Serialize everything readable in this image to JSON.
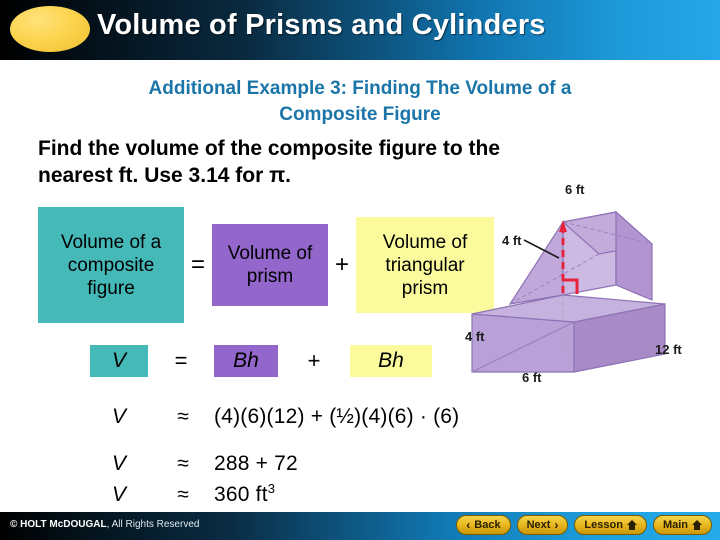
{
  "header": {
    "title": "Volume of Prisms and Cylinders",
    "ellipse_color": "#fcd44f",
    "gradient_start": "#000000",
    "gradient_end": "#25a6e6"
  },
  "subtitle": {
    "line1": "Additional Example 3: Finding The Volume of a",
    "line2": "Composite Figure",
    "color": "#1b75a8"
  },
  "problem": {
    "line1": "Find the volume of the composite figure to the",
    "line2": "nearest ft. Use 3.14 for ",
    "pi": "π."
  },
  "word_equation": {
    "term1": "Volume of a composite figure",
    "operator1": "=",
    "term2": "Volume of prism",
    "operator2": "+",
    "term3": "Volume of triangular prism",
    "term1_color": "#45b8b8",
    "term2_color": "#9366cc",
    "term3_color": "#fbfb9e"
  },
  "symbol_equation": {
    "lhs": "V",
    "operator1": "=",
    "term1": "Bh",
    "operator2": "+",
    "term2": "Bh"
  },
  "numeric_rows": [
    {
      "lhs": "V",
      "operator": "≈",
      "expression": "(4)(6)(12) + (½)(4)(6) · (6)"
    },
    {
      "lhs": "V",
      "operator": "≈",
      "expression": "288 +  72"
    },
    {
      "lhs": "V",
      "operator": "≈",
      "expression": "360 ft",
      "superscript": "3"
    }
  ],
  "figure": {
    "name": "composite-solid-rectangular-and-triangular-prism",
    "labels": {
      "top": "6 ft",
      "slant": "4 ft",
      "left_height": "4 ft",
      "length": "12 ft",
      "bottom_width": "6 ft"
    },
    "colors": {
      "front_face": "#a98cc8",
      "top_face": "#c9b4de",
      "side_face": "#b79ed2",
      "height_line": "#e8243c"
    }
  },
  "footer": {
    "copyright_bold": "© HOLT McDOUGAL",
    "copyright_rest": ", All Rights Reserved",
    "buttons": [
      {
        "label": "Back",
        "icon": "chevron-left-icon"
      },
      {
        "label": "Next",
        "icon": "chevron-right-icon"
      },
      {
        "label": "Lesson",
        "icon": "home-icon"
      },
      {
        "label": "Main",
        "icon": "home-icon"
      }
    ]
  }
}
